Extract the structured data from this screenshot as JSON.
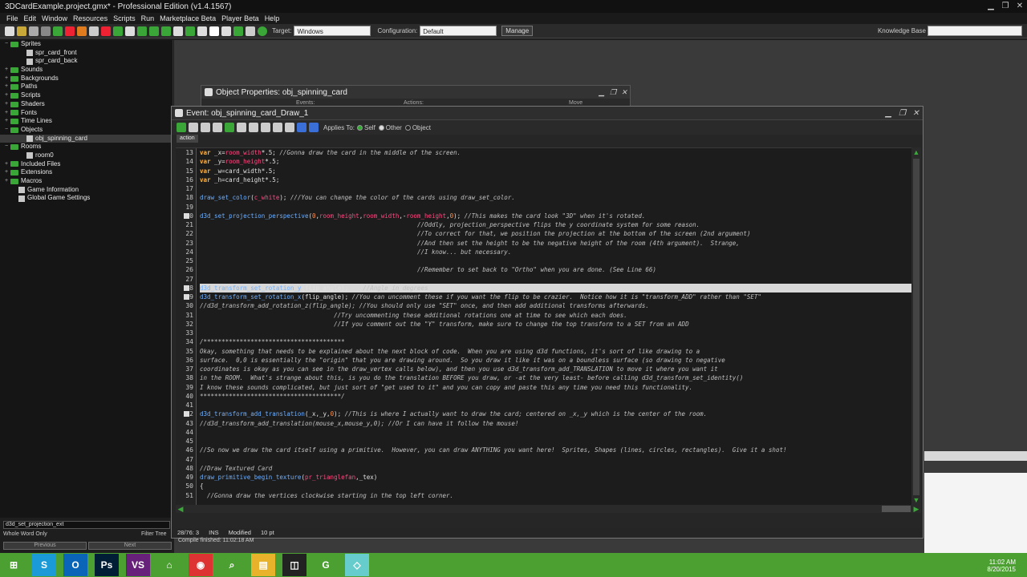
{
  "window": {
    "title": "3DCardExample.project.gmx* - Professional Edition (v1.4.1567)"
  },
  "menu": [
    "File",
    "Edit",
    "Window",
    "Resources",
    "Scripts",
    "Run",
    "Marketplace Beta",
    "Player Beta",
    "Help"
  ],
  "toolbar": {
    "target_label": "Target:",
    "target_value": "Windows",
    "config_label": "Configuration:",
    "config_value": "Default",
    "manage_label": "Manage",
    "kb_label": "Knowledge Base"
  },
  "tree": [
    {
      "label": "Sprites",
      "indent": 0,
      "type": "folder",
      "exp": "−"
    },
    {
      "label": "spr_card_front",
      "indent": 2,
      "type": "leaf"
    },
    {
      "label": "spr_card_back",
      "indent": 2,
      "type": "leaf"
    },
    {
      "label": "Sounds",
      "indent": 0,
      "type": "folder",
      "exp": "+"
    },
    {
      "label": "Backgrounds",
      "indent": 0,
      "type": "folder",
      "exp": "+"
    },
    {
      "label": "Paths",
      "indent": 0,
      "type": "folder",
      "exp": "+"
    },
    {
      "label": "Scripts",
      "indent": 0,
      "type": "folder",
      "exp": "+"
    },
    {
      "label": "Shaders",
      "indent": 0,
      "type": "folder",
      "exp": "+"
    },
    {
      "label": "Fonts",
      "indent": 0,
      "type": "folder",
      "exp": "+"
    },
    {
      "label": "Time Lines",
      "indent": 0,
      "type": "folder",
      "exp": "+"
    },
    {
      "label": "Objects",
      "indent": 0,
      "type": "folder",
      "exp": "−"
    },
    {
      "label": "obj_spinning_card",
      "indent": 2,
      "type": "leaf",
      "sel": true
    },
    {
      "label": "Rooms",
      "indent": 0,
      "type": "folder",
      "exp": "−"
    },
    {
      "label": "room0",
      "indent": 2,
      "type": "leaf"
    },
    {
      "label": "Included Files",
      "indent": 0,
      "type": "folder",
      "exp": "+"
    },
    {
      "label": "Extensions",
      "indent": 0,
      "type": "folder",
      "exp": "+"
    },
    {
      "label": "Macros",
      "indent": 0,
      "type": "folder",
      "exp": "+"
    },
    {
      "label": "Game Information",
      "indent": 1,
      "type": "leaf"
    },
    {
      "label": "Global Game Settings",
      "indent": 1,
      "type": "leaf"
    }
  ],
  "find": {
    "value": "d3d_set_projection_ext",
    "whole_word": "Whole Word Only",
    "filter": "Filter Tree",
    "prev": "Previous",
    "next": "Next"
  },
  "obj_window": {
    "title": "Object Properties: obj_spinning_card",
    "events": "Events:",
    "actions": "Actions:",
    "move": "Move"
  },
  "event_window": {
    "title": "Event: obj_spinning_card_Draw_1",
    "applies_to": "Applies To:",
    "self": "Self",
    "other": "Other",
    "object": "Object",
    "tab": "action"
  },
  "code": {
    "line_numbers": [
      "13",
      "14",
      "15",
      "16",
      "17",
      "18",
      "19",
      "20",
      "21",
      "22",
      "23",
      "24",
      "25",
      "26",
      "27",
      "28",
      "29",
      "30",
      "31",
      "32",
      "33",
      "34",
      "35",
      "36",
      "37",
      "38",
      "39",
      "40",
      "41",
      "42",
      "43",
      "44",
      "45",
      "46",
      "47",
      "48",
      "49",
      "50",
      "51"
    ],
    "lines": [
      [
        [
          "k",
          "var"
        ],
        [
          "t",
          " _x="
        ],
        [
          "v",
          "room_width"
        ],
        [
          "t",
          "*.5; "
        ],
        [
          "c",
          "//Gonna draw the card in the middle of the screen."
        ]
      ],
      [
        [
          "k",
          "var"
        ],
        [
          "t",
          " _y="
        ],
        [
          "v",
          "room_height"
        ],
        [
          "t",
          "*.5;"
        ]
      ],
      [
        [
          "k",
          "var"
        ],
        [
          "t",
          " _w=card_width*.5;"
        ]
      ],
      [
        [
          "k",
          "var"
        ],
        [
          "t",
          " _h=card_height*.5;"
        ]
      ],
      [],
      [
        [
          "f",
          "draw_set_color"
        ],
        [
          "t",
          "("
        ],
        [
          "v",
          "c_white"
        ],
        [
          "t",
          "); "
        ],
        [
          "c",
          "///You can change the color of the cards using draw_set_color."
        ]
      ],
      [],
      [
        [
          "f",
          "d3d_set_projection_perspective"
        ],
        [
          "t",
          "("
        ],
        [
          "n",
          "0"
        ],
        [
          "t",
          ","
        ],
        [
          "v",
          "room_height"
        ],
        [
          "t",
          ","
        ],
        [
          "v",
          "room_width"
        ],
        [
          "t",
          ",-"
        ],
        [
          "v",
          "room_height"
        ],
        [
          "t",
          ","
        ],
        [
          "n",
          "0"
        ],
        [
          "t",
          "); "
        ],
        [
          "c",
          "//This makes the card look \"3D\" when it's rotated."
        ]
      ],
      [
        [
          "t",
          "                                                            "
        ],
        [
          "c",
          "//Oddly, projection_perspective flips the y coordinate system for some reason."
        ]
      ],
      [
        [
          "t",
          "                                                            "
        ],
        [
          "c",
          "//To correct for that, we position the projection at the bottom of the screen (2nd argument)"
        ]
      ],
      [
        [
          "t",
          "                                                            "
        ],
        [
          "c",
          "//And then set the height to be the negative height of the room (4th argument).  Strange,"
        ]
      ],
      [
        [
          "t",
          "                                                            "
        ],
        [
          "c",
          "//I know... but necessary."
        ]
      ],
      [],
      [
        [
          "t",
          "                                                            "
        ],
        [
          "c",
          "//Remember to set back to \"Ortho\" when you are done. (See Line 66)"
        ]
      ],
      [],
      [
        [
          "f",
          "d3d_transform_set_rotation_y"
        ],
        [
          "t",
          "(flip_angle);    "
        ],
        [
          "c",
          "//Angle in degrees"
        ]
      ],
      [
        [
          "f",
          "d3d_transform_set_rotation_x"
        ],
        [
          "t",
          "(flip_angle); "
        ],
        [
          "c",
          "//You can uncomment these if you want the flip to be crazier.  Notice how it is \"transform_ADD\" rather than \"SET\""
        ]
      ],
      [
        [
          "c",
          "//d3d_transform_add_rotation_z(flip_angle); //You should only use \"SET\" once, and then add additional transforms afterwards."
        ]
      ],
      [
        [
          "t",
          "                                     "
        ],
        [
          "c",
          "//Try uncommenting these additional rotations one at time to see which each does."
        ]
      ],
      [
        [
          "t",
          "                                     "
        ],
        [
          "c",
          "//If you comment out the \"Y\" transform, make sure to change the top transform to a SET from an ADD"
        ]
      ],
      [],
      [
        [
          "c",
          "/***************************************"
        ]
      ],
      [
        [
          "c",
          "Okay, something that needs to be explained about the next block of code.  When you are using d3d functions, it's sort of like drawing to a"
        ]
      ],
      [
        [
          "c",
          "surface.  0,0 is essentially the \"origin\" that you are drawing around.  So you draw it like it was on a boundless surface (so drawing to negative"
        ]
      ],
      [
        [
          "c",
          "coordinates is okay as you can see in the draw_vertex calls below), and then you use d3d_transform_add_TRANSLATION to move it where you want it"
        ]
      ],
      [
        [
          "c",
          "in the ROOM.  What's strange about this, is you do the translation BEFORE you draw, or -at the very least- before calling d3d_transform_set_identity()"
        ]
      ],
      [
        [
          "c",
          "I know these sounds complicated, but just sort of \"get used to it\" and you can copy and paste this any time you need this functionality."
        ]
      ],
      [
        [
          "c",
          "***************************************/"
        ]
      ],
      [],
      [
        [
          "f",
          "d3d_transform_add_translation"
        ],
        [
          "t",
          "(_x,_y,"
        ],
        [
          "n",
          "0"
        ],
        [
          "t",
          "); "
        ],
        [
          "c",
          "//This is where I actually want to draw the card; centered on _x,_y which is the center of the room."
        ]
      ],
      [
        [
          "c",
          "//d3d_transform_add_translation(mouse_x,mouse_y,0); //Or I can have it follow the mouse!"
        ]
      ],
      [],
      [],
      [
        [
          "c",
          "//So now we draw the card itself using a primitive.  However, you can draw ANYTHING you want here!  Sprites, Shapes (lines, circles, rectangles).  Give it a shot!"
        ]
      ],
      [],
      [
        [
          "c",
          "//Draw Textured Card"
        ]
      ],
      [
        [
          "f",
          "draw_primitive_begin_texture"
        ],
        [
          "t",
          "("
        ],
        [
          "v",
          "pr_trianglefan"
        ],
        [
          "t",
          ",_tex)"
        ]
      ],
      [
        [
          "t",
          "{"
        ]
      ],
      [
        [
          "t",
          "  "
        ],
        [
          "c",
          "//Gonna draw the vertices clockwise starting in the top left corner."
        ]
      ]
    ]
  },
  "status": {
    "pos": "28/76: 3",
    "mode": "INS",
    "modified": "Modified",
    "size": "10 pt",
    "compile": "Compile finished: 11:02:18 AM"
  },
  "clock": {
    "time": "11:02 AM",
    "date": "8/20/2015"
  },
  "taskbar_icons": [
    "S",
    "O",
    "Ps",
    "VS",
    "⌂",
    "◉",
    "⌕",
    "▤",
    "◫",
    "G",
    "◇"
  ]
}
